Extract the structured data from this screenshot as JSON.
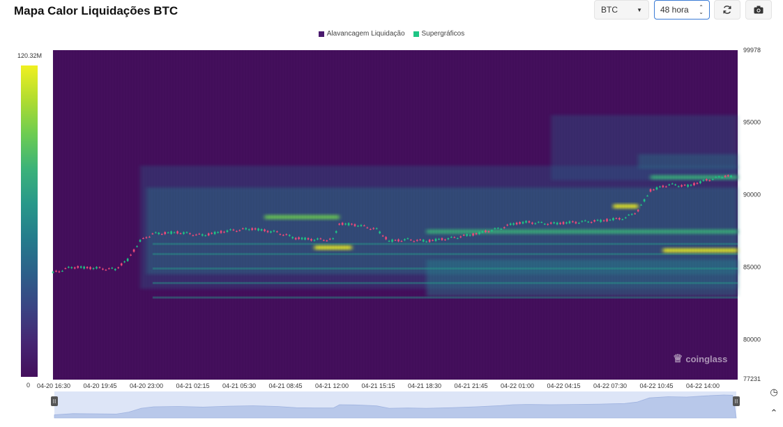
{
  "title": "Mapa Calor Liquidações BTC",
  "controls": {
    "coin": "BTC",
    "range": "48 hora",
    "refresh_icon": "refresh-icon",
    "camera_icon": "camera-icon"
  },
  "legend": [
    {
      "label": "Alavancagem Liquidação",
      "color": "#4a1a6e"
    },
    {
      "label": "Supergráficos",
      "color": "#1fc585"
    }
  ],
  "colorbar": {
    "max_label": "120.32M",
    "min_label": "0"
  },
  "watermark": "coinglass",
  "colors": {
    "low": "#440f5c",
    "mid": "#26828e",
    "high": "#f0f020",
    "up": "#1fc585",
    "down": "#ef4a7a"
  },
  "chart_data": {
    "type": "heatmap",
    "y_axis": {
      "ticks": [
        "99978",
        "95000",
        "90000",
        "85000",
        "80000",
        "77231"
      ],
      "min": 77231,
      "max": 99978
    },
    "x_axis": {
      "ticks": [
        "04-20 16:30",
        "04-20 19:45",
        "04-20 23:00",
        "04-21 02:15",
        "04-21 05:30",
        "04-21 08:45",
        "04-21 12:00",
        "04-21 15:15",
        "04-21 18:30",
        "04-21 21:45",
        "04-22 01:00",
        "04-22 04:15",
        "04-22 07:30",
        "04-22 10:45",
        "04-22 14:00"
      ]
    },
    "price_series": [
      {
        "t": 0,
        "p": 84600
      },
      {
        "t": 1.5,
        "p": 85000
      },
      {
        "t": 3,
        "p": 84950
      },
      {
        "t": 5,
        "p": 84850
      },
      {
        "t": 6,
        "p": 85500
      },
      {
        "t": 7,
        "p": 86800
      },
      {
        "t": 8,
        "p": 87300
      },
      {
        "t": 10,
        "p": 87400
      },
      {
        "t": 12,
        "p": 87200
      },
      {
        "t": 14,
        "p": 87500
      },
      {
        "t": 16,
        "p": 87650
      },
      {
        "t": 18,
        "p": 87400
      },
      {
        "t": 19.5,
        "p": 87000
      },
      {
        "t": 21,
        "p": 86900
      },
      {
        "t": 22.5,
        "p": 86900
      },
      {
        "t": 23,
        "p": 88000
      },
      {
        "t": 24.5,
        "p": 87900
      },
      {
        "t": 26,
        "p": 87600
      },
      {
        "t": 27,
        "p": 86800
      },
      {
        "t": 28.5,
        "p": 86900
      },
      {
        "t": 30,
        "p": 86800
      },
      {
        "t": 32,
        "p": 87000
      },
      {
        "t": 34,
        "p": 87300
      },
      {
        "t": 36,
        "p": 87700
      },
      {
        "t": 37,
        "p": 88000
      },
      {
        "t": 38,
        "p": 88100
      },
      {
        "t": 40,
        "p": 88000
      },
      {
        "t": 42,
        "p": 88100
      },
      {
        "t": 44,
        "p": 88200
      },
      {
        "t": 45,
        "p": 88300
      },
      {
        "t": 46,
        "p": 88400
      },
      {
        "t": 47,
        "p": 88900
      },
      {
        "t": 48,
        "p": 90300
      },
      {
        "t": 49.5,
        "p": 90700
      },
      {
        "t": 51,
        "p": 90600
      },
      {
        "t": 52.5,
        "p": 91000
      },
      {
        "t": 54,
        "p": 91300
      },
      {
        "t": 54.7,
        "p": 91200
      }
    ],
    "hot_bands": [
      {
        "price": 89200,
        "t_start": 45,
        "t_end": 47,
        "intensity": 1.0
      },
      {
        "price": 86150,
        "t_start": 49,
        "t_end": 55,
        "intensity": 0.95
      },
      {
        "price": 86350,
        "t_start": 21,
        "t_end": 24,
        "intensity": 0.9
      },
      {
        "price": 87450,
        "t_start": 30,
        "t_end": 55,
        "intensity": 0.55
      },
      {
        "price": 88450,
        "t_start": 17,
        "t_end": 23,
        "intensity": 0.6
      },
      {
        "price": 91200,
        "t_start": 48,
        "t_end": 55,
        "intensity": 0.5
      }
    ]
  }
}
